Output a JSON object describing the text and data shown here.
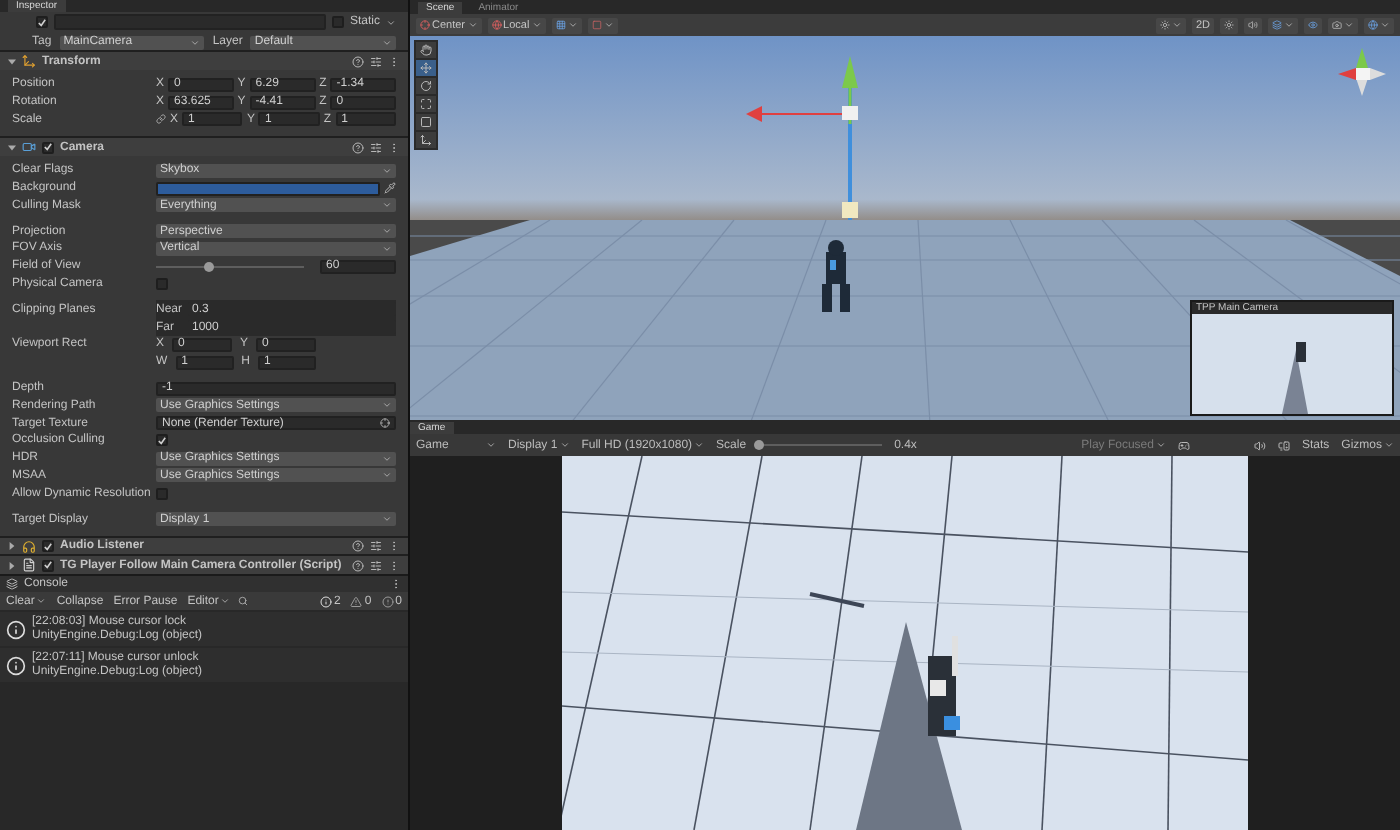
{
  "inspector": {
    "tab": "Inspector",
    "object": {
      "active": true,
      "static_label": "Static",
      "static": false
    },
    "tag_label": "Tag",
    "tag": "MainCamera",
    "layer_label": "Layer",
    "layer": "Default",
    "components": [
      {
        "title": "Transform",
        "kind": "transform",
        "expanded": true,
        "sections": [
          [
            {
              "label": "Position",
              "kind": "vec3",
              "axes": [
                {
                  "axis": "X",
                  "value": "0"
                },
                {
                  "axis": "Y",
                  "value": "6.29"
                },
                {
                  "axis": "Z",
                  "value": "-1.34"
                }
              ]
            },
            {
              "label": "Rotation",
              "kind": "vec3",
              "axes": [
                {
                  "axis": "X",
                  "value": "63.625"
                },
                {
                  "axis": "Y",
                  "value": "-4.41"
                },
                {
                  "axis": "Z",
                  "value": "0"
                }
              ]
            },
            {
              "label": "Scale",
              "kind": "vec3",
              "linked": true,
              "axes": [
                {
                  "axis": "X",
                  "value": "1"
                },
                {
                  "axis": "Y",
                  "value": "1"
                },
                {
                  "axis": "Z",
                  "value": "1"
                }
              ]
            }
          ]
        ]
      },
      {
        "title": "Camera",
        "kind": "camera",
        "enabled": true,
        "expanded": true,
        "sections": [
          [
            {
              "label": "Clear Flags",
              "kind": "dropdown",
              "value": "Skybox"
            },
            {
              "label": "Background",
              "kind": "color",
              "color": "#2d5c9c"
            },
            {
              "label": "Culling Mask",
              "kind": "dropdown",
              "value": "Everything"
            }
          ],
          [
            {
              "label": "Projection",
              "kind": "dropdown",
              "value": "Perspective"
            },
            {
              "label": "FOV Axis",
              "kind": "dropdown",
              "value": "Vertical"
            },
            {
              "label": "Field of View",
              "kind": "slider",
              "level": 0.36,
              "value": "60"
            },
            {
              "label": "Physical Camera",
              "kind": "checkbox",
              "checked": false
            }
          ],
          [
            {
              "label": "Clipping Planes",
              "kind": "pairs",
              "fields": [
                {
                  "label": "Near",
                  "value": "0.3"
                },
                {
                  "label": "Far",
                  "value": "1000"
                }
              ]
            },
            {
              "label": "Viewport Rect",
              "kind": "grid",
              "fields": [
                {
                  "label": "X",
                  "value": "0"
                },
                {
                  "label": "Y",
                  "value": "0"
                },
                {
                  "label": "W",
                  "value": "1"
                },
                {
                  "label": "H",
                  "value": "1"
                }
              ]
            }
          ],
          [
            {
              "label": "Depth",
              "kind": "text",
              "value": "-1"
            },
            {
              "label": "Rendering Path",
              "kind": "dropdown",
              "value": "Use Graphics Settings"
            },
            {
              "label": "Target Texture",
              "kind": "object",
              "value": "None (Render Texture)"
            },
            {
              "label": "Occlusion Culling",
              "kind": "checkbox",
              "checked": true
            },
            {
              "label": "HDR",
              "kind": "dropdown",
              "value": "Use Graphics Settings"
            },
            {
              "label": "MSAA",
              "kind": "dropdown",
              "value": "Use Graphics Settings"
            },
            {
              "label": "Allow Dynamic Resolution",
              "kind": "checkbox",
              "checked": false
            }
          ],
          [
            {
              "label": "Target Display",
              "kind": "dropdown",
              "value": "Display 1"
            }
          ]
        ]
      },
      {
        "title": "Audio Listener",
        "kind": "audio",
        "enabled": true,
        "expanded": false
      },
      {
        "title": "TG Player Follow Main Camera Controller (Script)",
        "kind": "script",
        "enabled": true,
        "expanded": false
      }
    ]
  },
  "console": {
    "title": "Console",
    "buttons": [
      {
        "label": "Clear",
        "menu": true
      },
      {
        "label": "Collapse",
        "menu": false
      },
      {
        "label": "Error Pause",
        "menu": false
      },
      {
        "label": "Editor",
        "menu": true
      }
    ],
    "counts": [
      {
        "kind": "info",
        "count": "2"
      },
      {
        "kind": "warning",
        "count": "0"
      },
      {
        "kind": "error",
        "count": "0"
      }
    ],
    "entries": [
      {
        "message": "[22:08:03] Mouse cursor lock",
        "source": "UnityEngine.Debug:Log (object)"
      },
      {
        "message": "[22:07:11] Mouse cursor unlock",
        "source": "UnityEngine.Debug:Log (object)"
      }
    ]
  },
  "scene": {
    "tabs": [
      {
        "label": "Scene",
        "selected": true
      },
      {
        "label": "Animator",
        "selected": false
      }
    ],
    "pivot": "Center",
    "space": "Local",
    "mode_2d": "2D",
    "preview_title": "TPP Main Camera"
  },
  "game": {
    "tab": "Game",
    "view": "Game",
    "display": "Display 1",
    "resolution": "Full HD (1920x1080)",
    "scale_label": "Scale",
    "scale_slider": {
      "level": 0.0
    },
    "scale_value": "0.4x",
    "play_mode": "Play Focused",
    "stats": "Stats",
    "gizmos": "Gizmos"
  }
}
